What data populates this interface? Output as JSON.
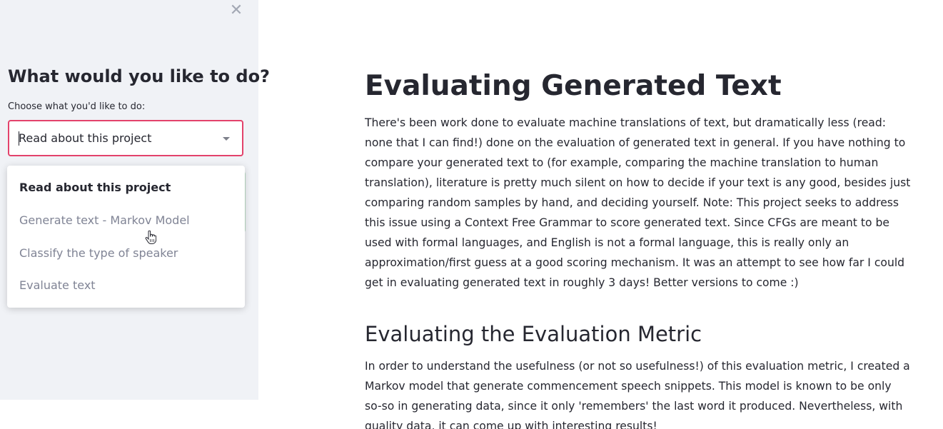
{
  "sidebar": {
    "close_icon": "close-icon",
    "heading": "What would you like to do?",
    "select_label": "Choose what you'd like to do:",
    "select_value": "Read about this project",
    "options": [
      "Read about this project",
      "Generate text - Markov Model",
      "Classify the type of speaker",
      "Evaluate text"
    ]
  },
  "main": {
    "title": "Evaluating Generated Text",
    "intro_lines": [
      "There's been work done to evaluate machine translations of text, but dramatically less (read:",
      "none that I can find!) done on the evaluation of generated text in general. If you have nothing to",
      "compare your generated text to (for example, comparing the machine translation to human",
      "translation), literature is pretty much silent on how to decide if your text is any good, besides just",
      "comparing random samples by hand, and deciding yourself. Note: This project seeks to address",
      "this issue using a Context Free Grammar to score generated text. Since CFGs are meant to be",
      "used with formal languages, and English is not a formal language, this is really only an",
      "approximation/first guess at a good scoring mechanism. It was an attempt to see how far I could",
      "get in evaluating generated text in roughly 3 days! Better versions to come :)"
    ],
    "subheading": "Evaluating the Evaluation Metric",
    "second_lines": [
      "In order to understand the usefulness (or not so usefulness!) of this evaluation metric, I created a",
      "Markov model that generate commencement speech snippets. This model is known to be only",
      "so-so in generating data, since it only 'remembers' the last word it produced. Nevertheless, with",
      "quality data, it can come up with interesting results!"
    ]
  },
  "colors": {
    "accent": "#e3426b",
    "sidebar_bg": "#f0f2f6",
    "text": "#262730",
    "muted": "#808495"
  }
}
